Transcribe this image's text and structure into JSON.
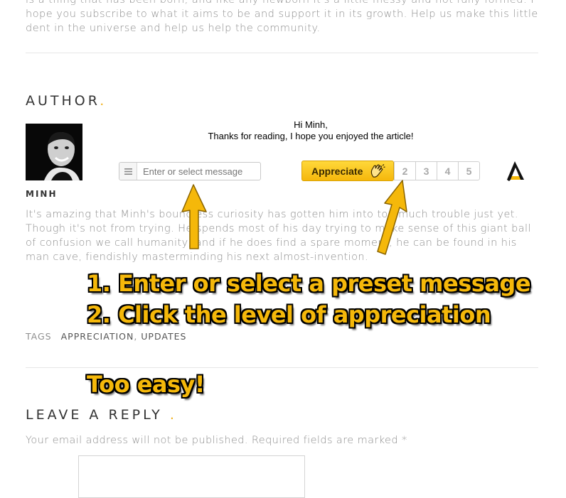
{
  "intro_text": "is a thing that has been born, and like any newborn it's a little messy and not fully formed. I hope you subscribe to what it aims to be and support it in its growth. Help us make this little dent in the universe and help us help the community.",
  "author_section": {
    "title": "AUTHOR",
    "title_dot": ".",
    "name": "MINH",
    "bio": "It's amazing that Minh's boundless curiosity has gotten him into too much trouble just yet. Though it's not from trying. He spends most of his day trying to make sense of this giant ball of confusion we call humanity, and if he does find a spare moment, he can be found in his man cave, fiendishly masterminding his next almost-invention."
  },
  "widget": {
    "greeting_line1": "Hi Minh,",
    "greeting_line2": "Thanks for reading, I hope you enjoyed the article!",
    "message_placeholder": "Enter or select message",
    "appreciate_label": "Appreciate",
    "levels": [
      "2",
      "3",
      "4",
      "5"
    ],
    "menu_icon": "hamburger-icon",
    "clap_icon": "clapping-hands-icon",
    "logo_icon": "appreciate-logo-icon"
  },
  "tags": {
    "label": "TAGS",
    "items": [
      "APPRECIATION",
      "UPDATES"
    ],
    "separator": ", "
  },
  "reply_section": {
    "title": "LEAVE A REPLY",
    "title_dot": ".",
    "note": "Your email address will not be published. Required fields are marked *"
  },
  "annotations": {
    "step1": "1. Enter or select a preset message",
    "step2": "2. Click the level of appreciation",
    "footer": "Too easy!"
  },
  "colors": {
    "accent": "#f1b21e",
    "annotation": "#f5b80a",
    "button_top": "#ffd83a",
    "button_bottom": "#f5b70c"
  }
}
